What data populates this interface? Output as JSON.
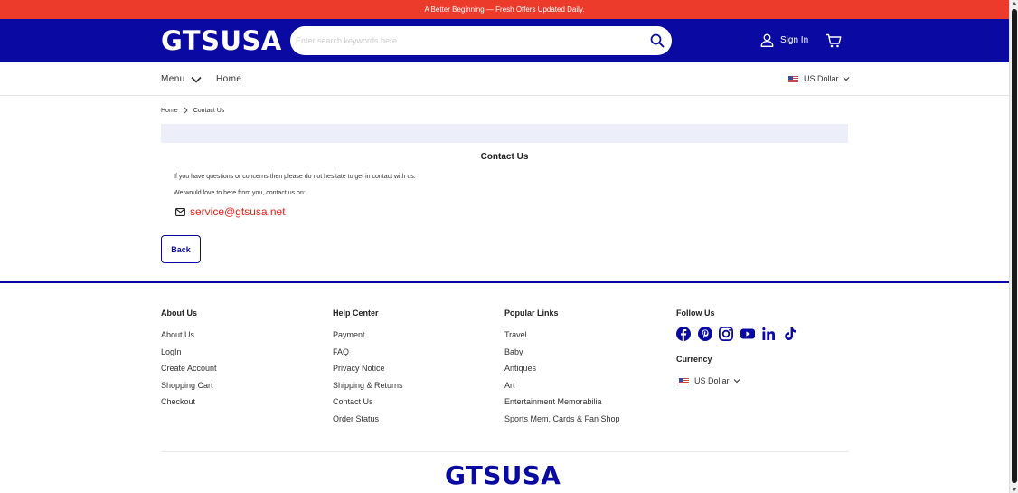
{
  "announcement": "A Better Beginning — Fresh Offers Updated Daily.",
  "header": {
    "logo": "GTSUSA",
    "search_placeholder": "Enter search keywords here",
    "signin_label": "Sign In"
  },
  "nav": {
    "menu_label": "Menu",
    "home_label": "Home",
    "currency": "US Dollar"
  },
  "breadcrumb": {
    "home": "Home",
    "current": "Contact Us"
  },
  "content": {
    "title": "Contact Us",
    "para1": "If you have questions or concerns then please do not hesitate to get in contact with us.",
    "para2": "We would love to here from you, contact us on:",
    "email": "service@gtsusa.net",
    "back_label": "Back"
  },
  "footer": {
    "about": {
      "title": "About Us",
      "links": [
        "About Us",
        "LogIn",
        "Create Account",
        "Shopping Cart",
        "Checkout"
      ]
    },
    "help": {
      "title": "Help Center",
      "links": [
        "Payment",
        "FAQ",
        "Privacy Notice",
        "Shipping & Returns",
        "Contact Us",
        "Order Status"
      ]
    },
    "popular": {
      "title": "Popular Links",
      "links": [
        "Travel",
        "Baby",
        "Antiques",
        "Art",
        "Entertainment Memorabilia",
        "Sports Mem, Cards & Fan Shop"
      ]
    },
    "follow_title": "Follow Us",
    "social_icons": [
      "facebook-icon",
      "pinterest-icon",
      "instagram-icon",
      "youtube-icon",
      "linkedin-icon",
      "tiktok-icon"
    ],
    "currency_title": "Currency",
    "currency": "US Dollar",
    "logo": "GTSUSA"
  },
  "colors": {
    "brand": "#0a0aa2",
    "announce": "#ec3a2b",
    "email": "#e8221c"
  }
}
